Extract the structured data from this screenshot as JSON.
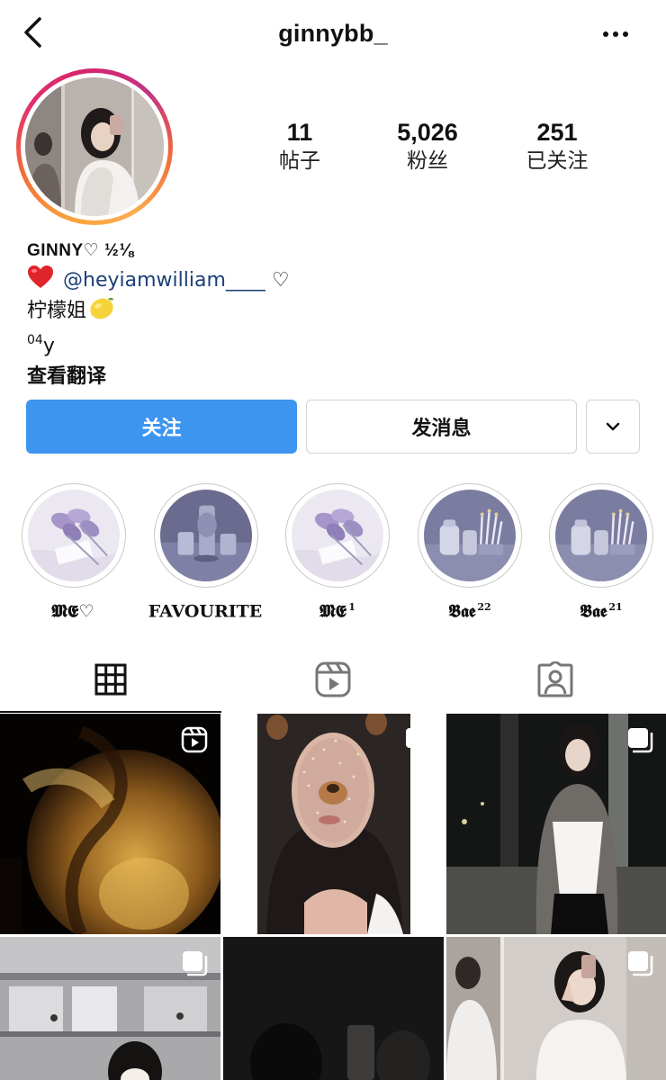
{
  "header": {
    "username": "ginnybb_",
    "back_icon": "chevron-left-icon",
    "more_icon": "more-horizontal-icon"
  },
  "stats": [
    {
      "value": "11",
      "label": "帖子"
    },
    {
      "value": "5,026",
      "label": "粉丝"
    },
    {
      "value": "251",
      "label": "已关注"
    }
  ],
  "bio": {
    "name": "GINNY♡ ½⅛",
    "mention": "@heyiamwilliam____",
    "mention_suffix": " ♡",
    "nickname": "柠檬姐",
    "age_sup": "04",
    "age_text": "y",
    "translate": "查看翻译"
  },
  "actions": {
    "follow": "关注",
    "message": "发消息"
  },
  "highlights": [
    {
      "label": "𝕸𝕰♡",
      "sup": ""
    },
    {
      "label": "FAVOURITE",
      "sup": ""
    },
    {
      "label": "𝕸𝕰",
      "sup": "1"
    },
    {
      "label": "𝕭𝖆𝖊",
      "sup": "22"
    },
    {
      "label": "𝕭𝖆𝖊",
      "sup": "21"
    }
  ],
  "tabs": [
    {
      "name": "posts",
      "icon": "grid-icon",
      "active": true
    },
    {
      "name": "reels",
      "icon": "reels-icon",
      "active": false
    },
    {
      "name": "tagged",
      "icon": "tagged-person-icon",
      "active": false
    }
  ],
  "colors": {
    "accent_blue": "#3d95f0",
    "mention_blue": "#1c3f78",
    "ring_gradient": [
      "#fbad50",
      "#e1306c",
      "#c13584"
    ]
  }
}
